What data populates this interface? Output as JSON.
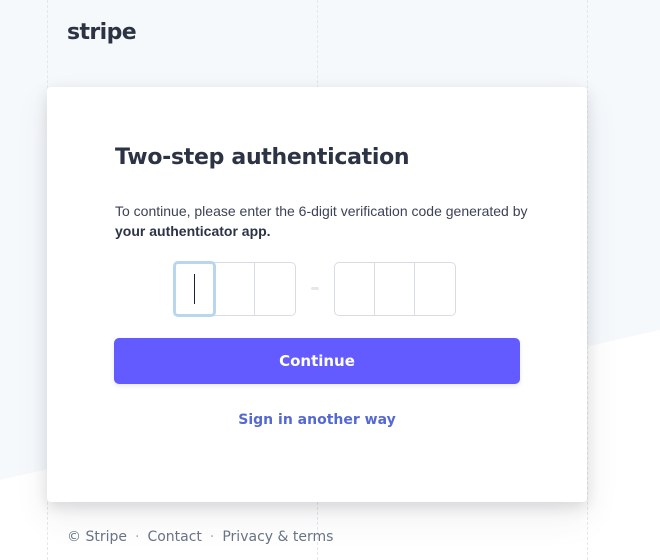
{
  "brand": {
    "logo_text": "stripe"
  },
  "card": {
    "title": "Two-step authentication",
    "description_prefix": "To continue, please enter the 6-digit verification code generated by ",
    "description_strong": "your authenticator app.",
    "code_inputs": [
      "",
      "",
      "",
      "",
      "",
      ""
    ],
    "continue_label": "Continue",
    "alt_link_label": "Sign in another way"
  },
  "footer": {
    "copyright": "© Stripe",
    "separator": "·",
    "contact": "Contact",
    "privacy": "Privacy & terms"
  },
  "colors": {
    "accent": "#635bff",
    "link": "#5469d4",
    "background": "#f6f9fc"
  }
}
